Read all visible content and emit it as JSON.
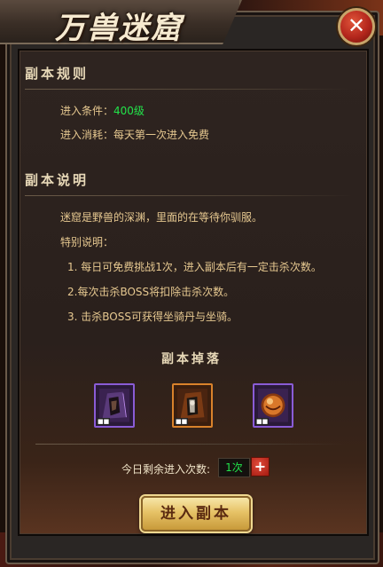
{
  "window": {
    "title": "万兽迷窟",
    "close_icon": "close-icon"
  },
  "rules": {
    "heading": "副本规则",
    "condition_label": "进入条件：",
    "condition_value": "400级",
    "cost_label": "进入消耗：",
    "cost_value": "每天第一次进入免费"
  },
  "description": {
    "heading": "副本说明",
    "intro": "迷窟是野兽的深渊，里面的在等待你驯服。",
    "special_title": "特别说明：",
    "notes": [
      "1. 每日可免费挑战1次，进入副本后有一定击杀次数。",
      "2.每次击杀BOSS将扣除击杀次数。",
      "3. 击杀BOSS可获得坐骑丹与坐骑。"
    ]
  },
  "rewards": {
    "heading": "副本掉落",
    "items": [
      {
        "name": "mount-card-purple-icon",
        "border": "#8a5cd6"
      },
      {
        "name": "mount-card-orange-icon",
        "border": "#d9822b"
      },
      {
        "name": "mount-pill-orb-icon",
        "border": "#8a5cd6"
      }
    ]
  },
  "entries": {
    "label": "今日剩余进入次数:",
    "value": "1次",
    "plus_icon": "plus-icon"
  },
  "enter_button": {
    "label": "进入副本"
  },
  "colors": {
    "highlight_green": "#22e34a",
    "text_gold": "#e6c890",
    "button_gold": "#e6c266"
  }
}
